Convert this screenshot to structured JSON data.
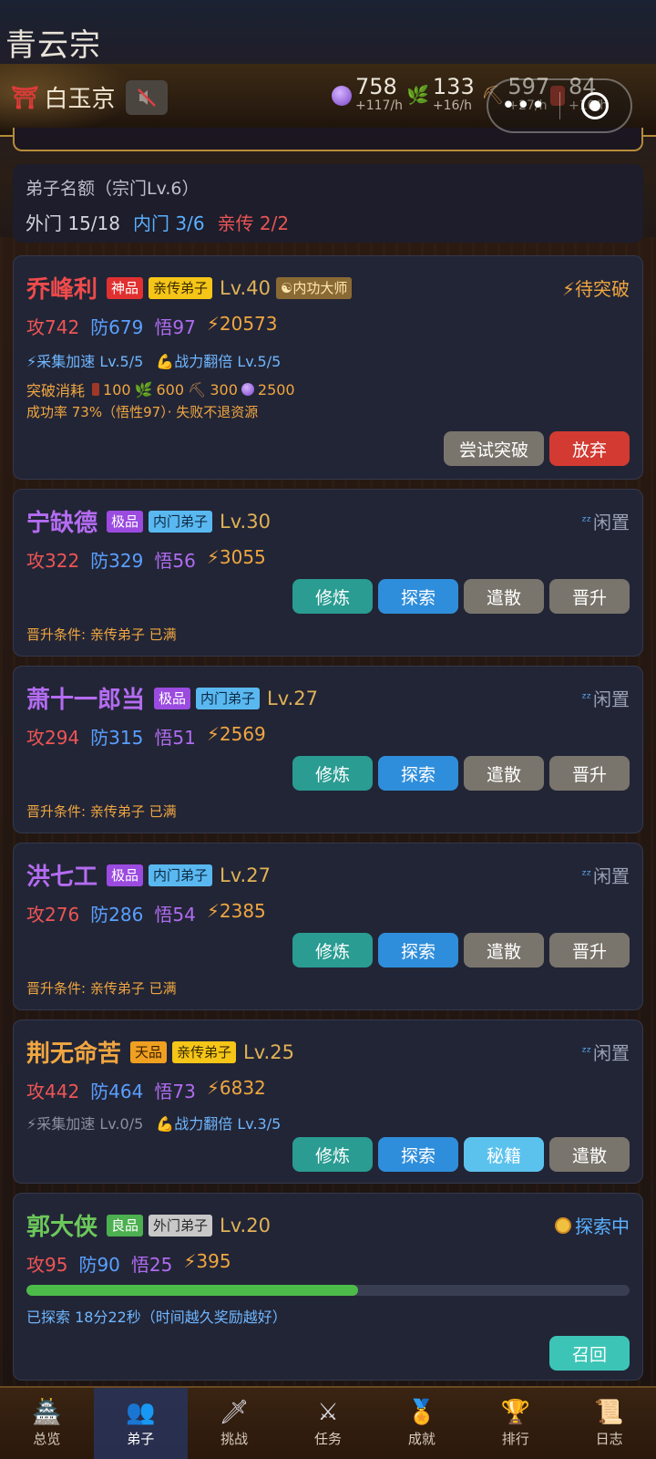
{
  "sect_title": "青云宗",
  "location": "白玉京",
  "resources": [
    {
      "icon": "spirit-orb-icon",
      "value": "758",
      "rate": "+117/h",
      "color": "#a070e0"
    },
    {
      "icon": "herb-icon",
      "value": "133",
      "rate": "+16/h",
      "color": "#6ec24a"
    },
    {
      "icon": "pickaxe-icon",
      "value": "597",
      "rate": "+27/h",
      "color": "#c08a50"
    },
    {
      "icon": "wood-icon",
      "value": "84",
      "rate": "+10/h",
      "color": "#b04030"
    }
  ],
  "quota": {
    "title": "弟子名额（宗门Lv.6）",
    "outer": "外门 15/18",
    "inner": "内门 3/6",
    "core": "亲传 2/2"
  },
  "disciples": [
    {
      "name": "乔峰利",
      "name_color": "#ee4b4b",
      "grade": "神品",
      "grade_bg": "#e03030",
      "grade_fg": "#ffffff",
      "rank": "亲传弟子",
      "rank_bg": "#f5c518",
      "rank_fg": "#3a2a00",
      "level": "Lv.40",
      "title_badge": "☯内功大师",
      "status": "⚡待突破",
      "status_color": "#f0a640",
      "atk": "攻742",
      "def": "防679",
      "wu": "悟97",
      "power": "⚡20573",
      "skill1": "⚡采集加速 Lv.5/5",
      "skill2": "💪战力翻倍 Lv.5/5",
      "cost_label": "突破消耗",
      "cost_wood": "100",
      "cost_herb": "600",
      "cost_ore": "300",
      "cost_orb": "2500",
      "success": "成功率 73%（悟性97）· 失败不退资源",
      "buttons": [
        "尝试突破",
        "放弃"
      ]
    },
    {
      "name": "宁缺德",
      "name_color": "#b46cf2",
      "grade": "极品",
      "grade_bg": "#9b4be0",
      "grade_fg": "#ffffff",
      "rank": "内门弟子",
      "rank_bg": "#5ab8f0",
      "rank_fg": "#0d2a45",
      "level": "Lv.30",
      "status": "闲置",
      "status_color": "#9aa0b4",
      "atk": "攻322",
      "def": "防329",
      "wu": "悟56",
      "power": "⚡3055",
      "buttons": [
        "修炼",
        "探索",
        "遣散",
        "晋升"
      ],
      "note": "晋升条件: 亲传弟子 已满"
    },
    {
      "name": "萧十一郎当",
      "name_color": "#b46cf2",
      "grade": "极品",
      "grade_bg": "#9b4be0",
      "grade_fg": "#ffffff",
      "rank": "内门弟子",
      "rank_bg": "#5ab8f0",
      "rank_fg": "#0d2a45",
      "level": "Lv.27",
      "status": "闲置",
      "status_color": "#9aa0b4",
      "atk": "攻294",
      "def": "防315",
      "wu": "悟51",
      "power": "⚡2569",
      "buttons": [
        "修炼",
        "探索",
        "遣散",
        "晋升"
      ],
      "note": "晋升条件: 亲传弟子 已满"
    },
    {
      "name": "洪七工",
      "name_color": "#b46cf2",
      "grade": "极品",
      "grade_bg": "#9b4be0",
      "grade_fg": "#ffffff",
      "rank": "内门弟子",
      "rank_bg": "#5ab8f0",
      "rank_fg": "#0d2a45",
      "level": "Lv.27",
      "status": "闲置",
      "status_color": "#9aa0b4",
      "atk": "攻276",
      "def": "防286",
      "wu": "悟54",
      "power": "⚡2385",
      "buttons": [
        "修炼",
        "探索",
        "遣散",
        "晋升"
      ],
      "note": "晋升条件: 亲传弟子 已满"
    },
    {
      "name": "荆无命苦",
      "name_color": "#f0a640",
      "grade": "天品",
      "grade_bg": "#f0a020",
      "grade_fg": "#3a2000",
      "rank": "亲传弟子",
      "rank_bg": "#f5c518",
      "rank_fg": "#3a2a00",
      "level": "Lv.25",
      "status": "闲置",
      "status_color": "#9aa0b4",
      "atk": "攻442",
      "def": "防464",
      "wu": "悟73",
      "power": "⚡6832",
      "skill1": "⚡采集加速 Lv.0/5",
      "skill2": "💪战力翻倍 Lv.3/5",
      "buttons": [
        "修炼",
        "探索",
        "秘籍",
        "遣散"
      ]
    },
    {
      "name": "郭大侠",
      "name_color": "#6cc85a",
      "grade": "良品",
      "grade_bg": "#4caf50",
      "grade_fg": "#ffffff",
      "rank": "外门弟子",
      "rank_bg": "#c8c8c8",
      "rank_fg": "#2a2a2a",
      "level": "Lv.20",
      "status": "探索中",
      "status_color": "#5ab0ff",
      "atk": "攻95",
      "def": "防90",
      "wu": "悟25",
      "power": "⚡395",
      "progress": 0.55,
      "explore_text": "已探索 18分22秒（时间越久奖励越好）",
      "buttons": [
        "召回"
      ]
    }
  ],
  "tabs": [
    {
      "label": "总览",
      "icon": "🏯"
    },
    {
      "label": "弟子",
      "icon": "👥"
    },
    {
      "label": "挑战",
      "icon": "🗡"
    },
    {
      "label": "任务",
      "icon": "⚔"
    },
    {
      "label": "成就",
      "icon": "🏅"
    },
    {
      "label": "排行",
      "icon": "🏆"
    },
    {
      "label": "日志",
      "icon": "📜"
    }
  ]
}
